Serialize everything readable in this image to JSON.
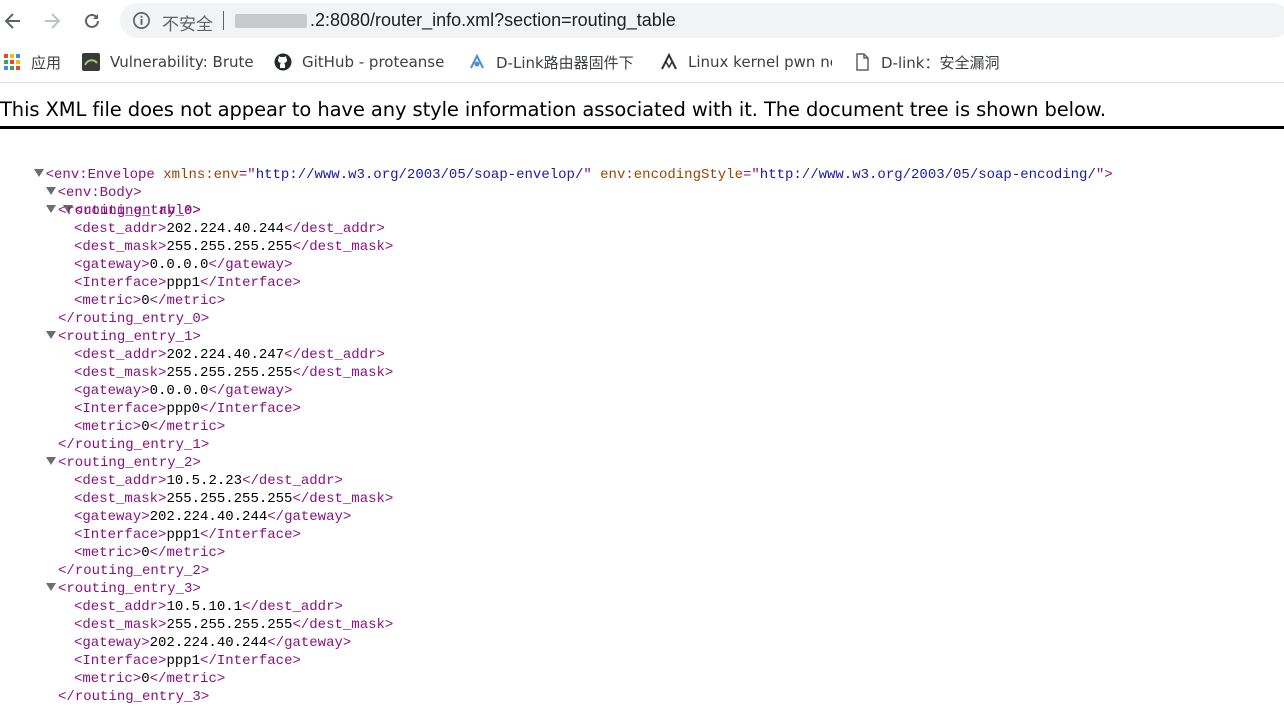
{
  "browser": {
    "security_label": "不安全",
    "url_tail": ".2:8080/router_info.xml?section=routing_table",
    "bookmarks": [
      {
        "label": "应用",
        "icon": "apps-grid-icon"
      },
      {
        "label": "Vulnerability: Brute",
        "icon": "dvwa-icon"
      },
      {
        "label": "GitHub - proteanse",
        "icon": "github-icon"
      },
      {
        "label": "D-Link路由器固件下",
        "icon": "dlink-icon"
      },
      {
        "label": "Linux kernel pwn nc",
        "icon": "linux-icon"
      },
      {
        "label": "D-link：安全漏洞",
        "icon": "document-icon"
      }
    ]
  },
  "xml_header": "This XML file does not appear to have any style information associated with it. The document tree is shown below.",
  "envelope": {
    "open_name": "env:Envelope",
    "xmlns_attr": "xmlns:env",
    "xmlns_value": "http://www.w3.org/2003/05/soap-envelop/",
    "style_attr": "env:encodingStyle",
    "style_value": "http://www.w3.org/2003/05/soap-encoding/",
    "body_tag": "env:Body",
    "table_tag": "routing_table"
  },
  "entries": [
    {
      "tag": "routing_entry_0",
      "dest_addr": "202.224.40.244",
      "dest_mask": "255.255.255.255",
      "gateway": "0.0.0.0",
      "interface": "ppp1",
      "metric": "0"
    },
    {
      "tag": "routing_entry_1",
      "dest_addr": "202.224.40.247",
      "dest_mask": "255.255.255.255",
      "gateway": "0.0.0.0",
      "interface": "ppp0",
      "metric": "0"
    },
    {
      "tag": "routing_entry_2",
      "dest_addr": "10.5.2.23",
      "dest_mask": "255.255.255.255",
      "gateway": "202.224.40.244",
      "interface": "ppp1",
      "metric": "0"
    },
    {
      "tag": "routing_entry_3",
      "dest_addr": "10.5.10.1",
      "dest_mask": "255.255.255.255",
      "gateway": "202.224.40.244",
      "interface": "ppp1",
      "metric": "0"
    }
  ],
  "field_tags": {
    "dest_addr": "dest_addr",
    "dest_mask": "dest_mask",
    "gateway": "gateway",
    "interface": "Interface",
    "metric": "metric"
  }
}
